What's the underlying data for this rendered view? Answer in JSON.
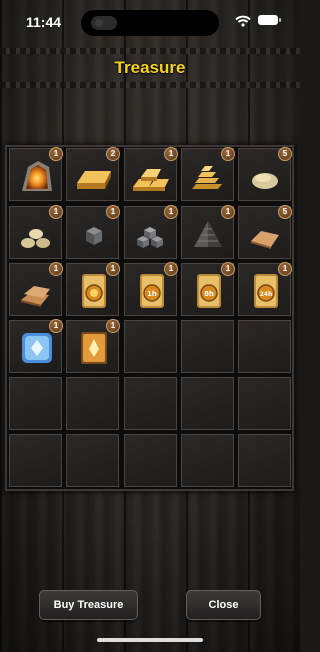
{
  "status_bar": {
    "time": "11:44"
  },
  "title": "Treasure",
  "inventory": [
    {
      "item": "fire-crystal",
      "count": "1"
    },
    {
      "item": "gold-bar",
      "count": "2"
    },
    {
      "item": "gold-bars-stack",
      "count": "1"
    },
    {
      "item": "gold-bars-pyramid",
      "count": "1"
    },
    {
      "item": "stone",
      "count": "5"
    },
    {
      "item": "stones-pile",
      "count": "1"
    },
    {
      "item": "iron-cube",
      "count": "1"
    },
    {
      "item": "iron-cubes",
      "count": "1"
    },
    {
      "item": "iron-pyramid",
      "count": "1"
    },
    {
      "item": "cloth-bundle",
      "count": "5"
    },
    {
      "item": "cloth-stack",
      "count": "1"
    },
    {
      "item": "gold-token-scroll",
      "count": "1"
    },
    {
      "item": "gold-token-scroll-1h",
      "count": "1"
    },
    {
      "item": "gold-token-scroll-8h",
      "count": "1"
    },
    {
      "item": "gold-token-scroll-24h",
      "count": "1"
    },
    {
      "item": "blue-crystal-scroll",
      "count": "1"
    },
    {
      "item": "fire-tome",
      "count": "1"
    }
  ],
  "token_labels": {
    "t1": "1h",
    "t8": "8h",
    "t24": "24h"
  },
  "buttons": {
    "buy": "Buy Treasure",
    "close": "Close"
  },
  "colors": {
    "title": "#f7d21c",
    "gold": "#d9a23a",
    "badge": "#7a4a24"
  }
}
